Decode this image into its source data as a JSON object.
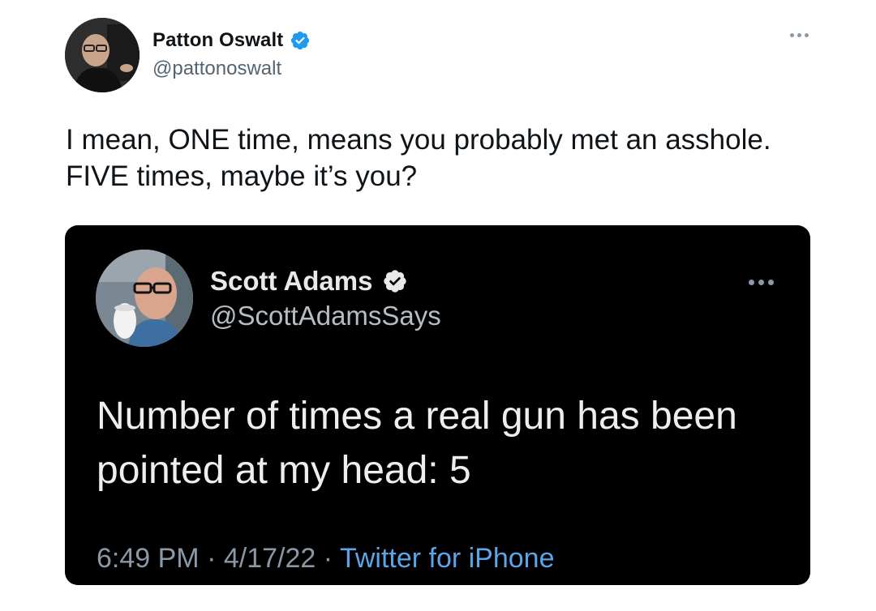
{
  "tweet": {
    "author": {
      "display_name": "Patton Oswalt",
      "handle": "@pattonoswalt",
      "verified": true,
      "avatar_icon": "profile-photo"
    },
    "text": "I mean, ONE time, means you probably met an asshole.\nFIVE times, maybe it’s you?",
    "more_icon": "more-horizontal-icon"
  },
  "quoted_screenshot": {
    "author": {
      "display_name": "Scott Adams",
      "handle": "@ScottAdamsSays",
      "verified": true,
      "avatar_icon": "profile-photo"
    },
    "text": "Number of times a real gun has been\npointed at my head: 5",
    "time": "6:49 PM",
    "date": "4/17/22",
    "separator": "·",
    "source": "Twitter for iPhone"
  },
  "colors": {
    "verified_blue": "#1d9bf0",
    "link_blue": "#5aa6e8",
    "embed_background": "#000000"
  }
}
